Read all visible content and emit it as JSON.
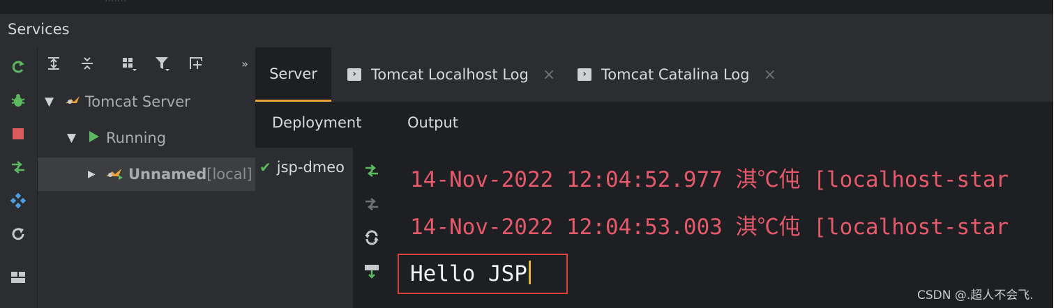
{
  "panel": {
    "title": "Services"
  },
  "colors": {
    "accent": "#e9a23b",
    "log_text": "#e5596a",
    "running": "#5bb95f",
    "highlight_box": "#d9413a"
  },
  "left_toolbar": {
    "icons": [
      "rerun-icon",
      "debug-icon",
      "stop-icon",
      "deploy-icon",
      "services-icon",
      "refresh-icon",
      "layout-icon"
    ]
  },
  "tree_toolbar": {
    "icons": [
      "expand-all-icon",
      "collapse-all-icon",
      "group-icon",
      "filter-icon",
      "add-service-icon",
      "more-icon"
    ],
    "more_label": "»"
  },
  "tree": {
    "root": {
      "label": "Tomcat Server",
      "icon": "tomcat-icon"
    },
    "group": {
      "label": "Running"
    },
    "item": {
      "name": "Unnamed",
      "suffix": " [local]"
    }
  },
  "tabs": [
    {
      "label": "Server",
      "active": true
    },
    {
      "label": "Tomcat Localhost Log",
      "active": false,
      "close": "×"
    },
    {
      "label": "Tomcat Catalina Log",
      "active": false,
      "close": "×"
    }
  ],
  "subtabs": {
    "deployment": "Deployment",
    "output": "Output"
  },
  "deployment": {
    "item": "jsp-dmeo"
  },
  "console": {
    "lines": [
      "14-Nov-2022 12:04:52.977 淇℃伅 [localhost-star",
      "14-Nov-2022 12:04:53.003 淇℃伅 [localhost-star"
    ],
    "current_input": "Hello JSP"
  },
  "watermark": "CSDN @.超人不会飞."
}
